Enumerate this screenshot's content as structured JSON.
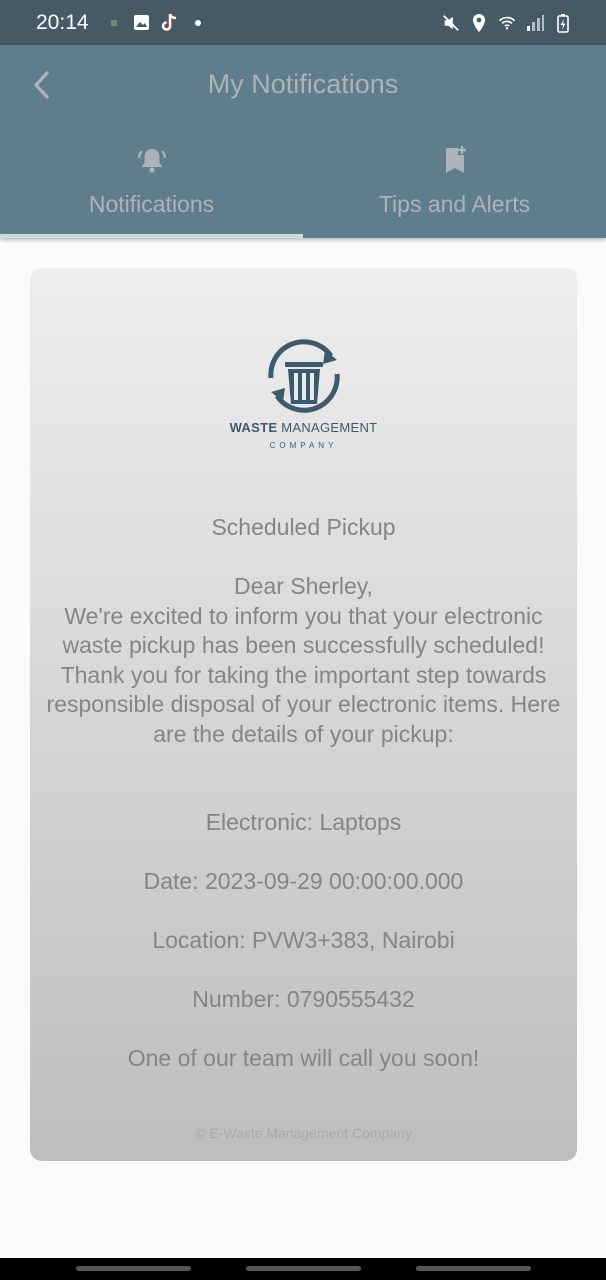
{
  "status_bar": {
    "time": "20:14",
    "left_icons": [
      "app-notification-icon",
      "image-icon",
      "tiktok-icon",
      "dot-icon"
    ],
    "right_icons": [
      "mute-icon",
      "location-icon",
      "wifi-icon",
      "signal-icon",
      "battery-charging-icon"
    ]
  },
  "app_bar": {
    "title": "My Notifications",
    "back_icon": "chevron-left-icon"
  },
  "tabs": [
    {
      "label": "Notifications",
      "icon": "bell-icon",
      "selected": true
    },
    {
      "label": "Tips and Alerts",
      "icon": "bookmark-add-icon",
      "selected": false
    }
  ],
  "notification": {
    "logo_word_bold": "WASTE",
    "logo_word_rest": " MANAGEMENT",
    "logo_sub": "COMPANY",
    "title": "Scheduled Pickup",
    "greeting": "Dear Sherley,",
    "body": "We're excited to inform you that your electronic waste pickup has been successfully scheduled! Thank you for taking the important step towards responsible disposal of your electronic items. Here are the details of your pickup:",
    "electronic": "Electronic: Laptops",
    "date": "Date: 2023-09-29 00:00:00.000",
    "location": "Location: PVW3+383, Nairobi",
    "number": "Number: 0790555432",
    "closing": "One of our team will call you soon!",
    "footer": "© E-Waste Management Company"
  },
  "colors": {
    "status_bar": "#455a64",
    "app_bar": "#607d8b",
    "muted_text": "#aab4b9",
    "card_top": "#eeeeee",
    "card_bottom": "#bdbdbd",
    "logo": "#3d5a6c"
  }
}
